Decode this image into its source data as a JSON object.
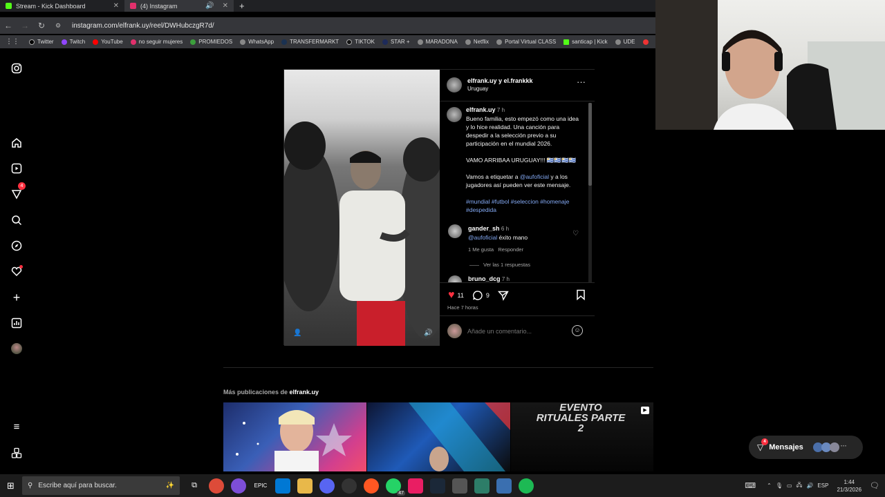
{
  "tabs": [
    {
      "label": "Stream - Kick Dashboard",
      "color": "#53fc18",
      "active": false
    },
    {
      "label": "(4) Instagram",
      "color": "#e1306c",
      "active": true
    }
  ],
  "address": {
    "url": "instagram.com/elfrank.uy/reel/DWHubczgR7d/"
  },
  "bookmarks": [
    "Twitter",
    "Twitch",
    "YouTube",
    "no seguir mujeres",
    "PROMIEDOS",
    "WhatsApp",
    "TRANSFERMARKT",
    "TIKTOK",
    "STAR +",
    "MARADONA",
    "Netflix",
    "Portal Virtual CLASS",
    "santicap | Kick",
    "UDE"
  ],
  "rail": {
    "notif_count": "4"
  },
  "post": {
    "header_user": "elfrank.uy y el.frankkk",
    "header_location": "Uruguay",
    "caption_user": "elfrank.uy",
    "caption_time": "7 h",
    "caption_1": "Bueno familia, esto empezó como una idea y lo hice realidad. Una canción para despedir a la selección previo a su participación en el mundial 2026.",
    "caption_2": "VAMO ARRIBAA URUGUAY!!! 🇺🇾🇺🇾🇺🇾🇺🇾",
    "caption_3a": "Vamos a etiquetar a ",
    "caption_3_mention": "@aufoficial",
    "caption_3b": " y a los jugadores así pueden ver este mensaje.",
    "hashtags": "#mundial #futbol #seleccion #homenaje #despedida",
    "comments": [
      {
        "user": "gander_sh",
        "time": "6 h",
        "mention": "@aufoficial",
        "text": " éxito mano",
        "likes": "1 Me gusta",
        "reply": "Responder",
        "replies": "Ver las 1 respuestas"
      },
      {
        "user": "bruno_dcg",
        "time": "7 h"
      }
    ],
    "likes_count": "11",
    "comments_count": "9",
    "time_ago": "Hace 7 horas",
    "comment_placeholder": "Añade un comentario..."
  },
  "more": {
    "prefix": "Más publicaciones de ",
    "user": "elfrank.uy",
    "thumb3_text": "EVENTO RITUALES PARTE 2"
  },
  "messages": {
    "label": "Mensajes",
    "count": "4"
  },
  "taskbar": {
    "search_placeholder": "Escribe aquí para buscar.",
    "lang": "ESP",
    "time": "1:44",
    "date": "21/3/2026",
    "badge": "47"
  }
}
